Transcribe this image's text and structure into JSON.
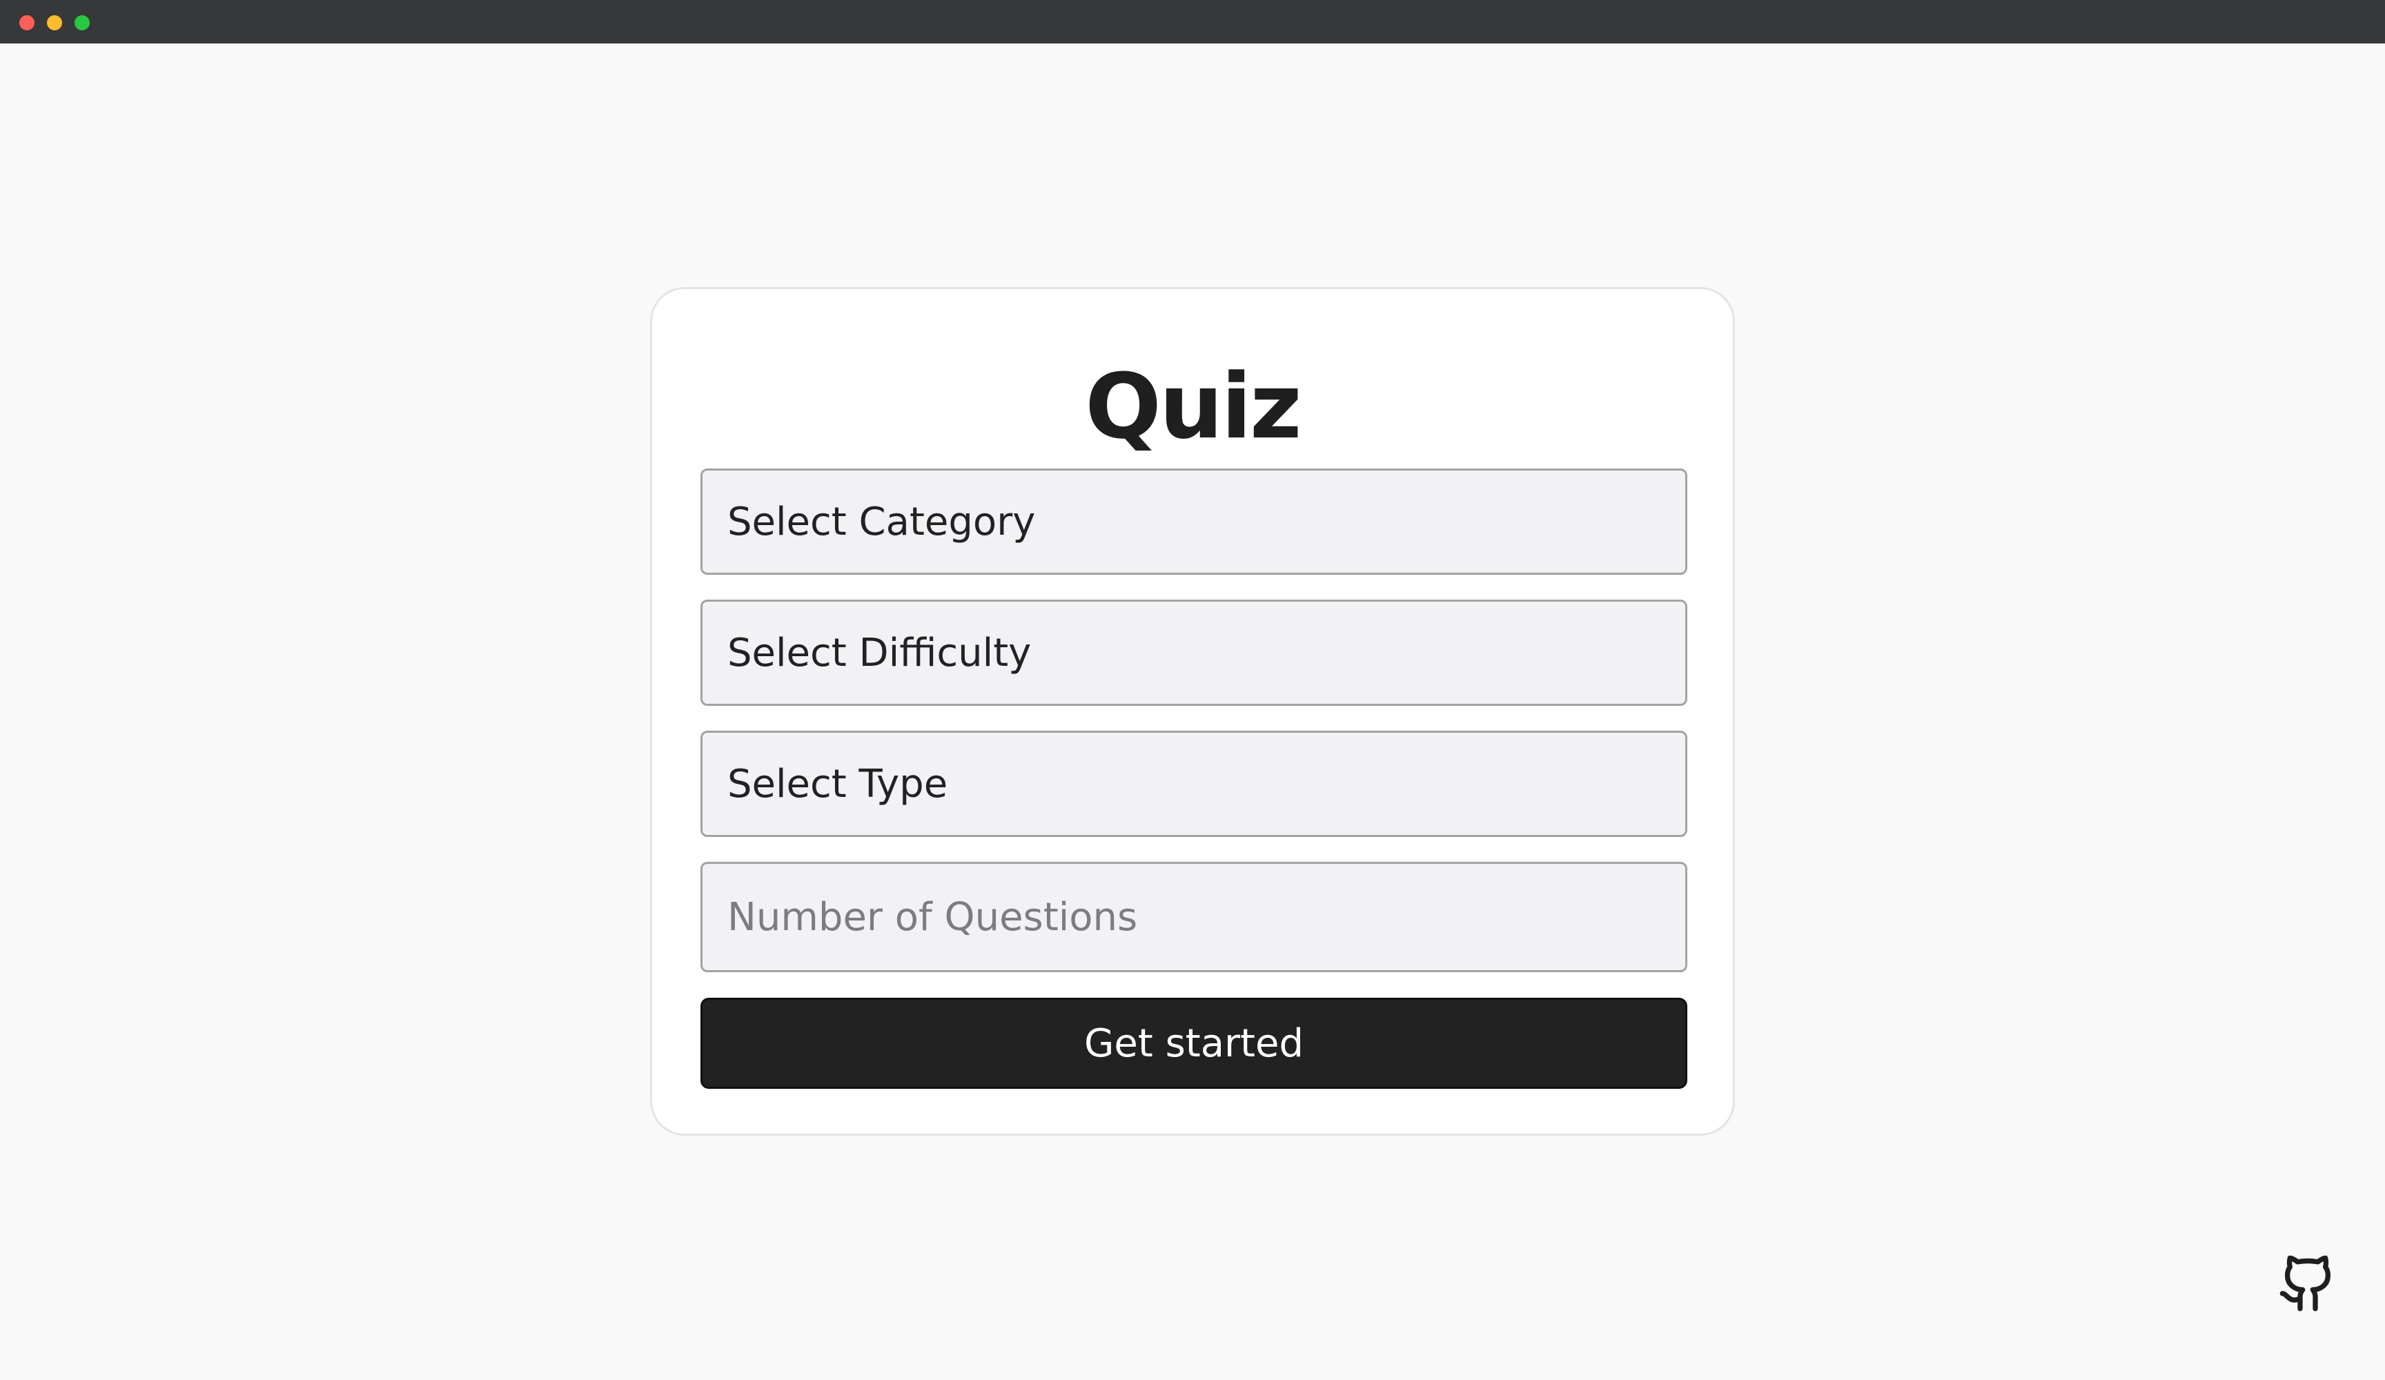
{
  "window": {
    "controls": [
      "close",
      "minimize",
      "maximize"
    ]
  },
  "quiz": {
    "title": "Quiz",
    "category_select": {
      "value": "Select Category"
    },
    "difficulty_select": {
      "value": "Select Difficulty"
    },
    "type_select": {
      "value": "Select Type"
    },
    "questions_input": {
      "value": "",
      "placeholder": "Number of Questions"
    },
    "start_button": {
      "label": "Get started"
    }
  },
  "footer": {
    "icon": "github-icon"
  },
  "colors": {
    "background": "#f9f9f9",
    "card": "#ffffff",
    "button": "#222222",
    "field": "#f2f2f4"
  }
}
